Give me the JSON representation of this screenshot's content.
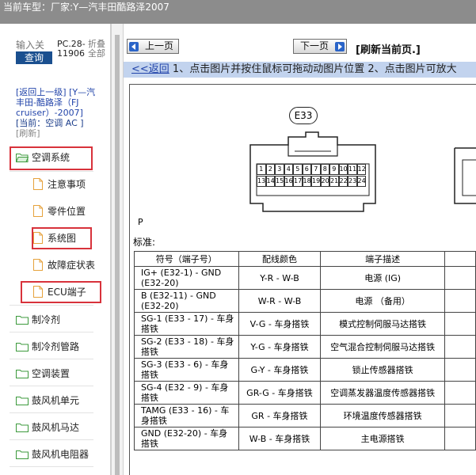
{
  "topbar": {
    "label": "当前车型：",
    "vehicle": "厂家:Y—汽丰田酷路泽2007"
  },
  "left": {
    "search_placeholder": "输入关",
    "search_button": "查询",
    "version_line1": "PC.28-",
    "version_line2": "11906",
    "fold_line1": "折叠",
    "fold_line2": "全部",
    "nav": {
      "back_parent": "[返回上一级]",
      "path": "[Y—汽丰田-酷路泽（FJ cruiser）-2007]",
      "current": "[当前：空调 AC ]",
      "refresh": "[刷新]"
    },
    "tree": [
      {
        "label": "空调系统",
        "type": "folder-open",
        "highlighted": true
      },
      {
        "label": "注意事项",
        "type": "doc",
        "highlighted": false
      },
      {
        "label": "零件位置",
        "type": "doc",
        "highlighted": false
      },
      {
        "label": "系统图",
        "type": "doc",
        "highlighted": true
      },
      {
        "label": "故障症状表",
        "type": "doc",
        "highlighted": false
      },
      {
        "label": "ECU端子",
        "type": "doc",
        "highlighted": true
      },
      {
        "label": "制冷剂",
        "type": "folder",
        "highlighted": false
      },
      {
        "label": "制冷剂管路",
        "type": "folder",
        "highlighted": false
      },
      {
        "label": "空调装置",
        "type": "folder",
        "highlighted": false
      },
      {
        "label": "鼓风机单元",
        "type": "folder",
        "highlighted": false
      },
      {
        "label": "鼓风机马达",
        "type": "folder",
        "highlighted": false
      },
      {
        "label": "鼓风机电阻器",
        "type": "folder",
        "highlighted": false
      }
    ]
  },
  "right": {
    "prev_button": "上一页",
    "next_button": "下一页",
    "refresh_page": "[刷新当前页.]",
    "hint_back": "<<返回",
    "hint_text": " 1、点击图片并按住鼠标可拖动动图片位置 2、点击图片可放大",
    "diagram": {
      "connector": "E33",
      "pins_row1": [
        "1",
        "2",
        "3",
        "4",
        "5",
        "6",
        "7",
        "8",
        "9",
        "10",
        "11",
        "12"
      ],
      "pins_row2": [
        "13",
        "14",
        "15",
        "16",
        "17",
        "18",
        "19",
        "20",
        "21",
        "22",
        "23",
        "24"
      ],
      "view_label": "P",
      "standard_label": "标准:",
      "table": {
        "headers": [
          "符号（端子号）",
          "配线颜色",
          "端子描述"
        ],
        "rows": [
          [
            "IG+ (E32-1) - GND (E32-20)",
            "Y-R - W-B",
            "电源 (IG)"
          ],
          [
            "B (E32-11) - GND (E32-20)",
            "W-R - W-B",
            "电源 （备用）"
          ],
          [
            "SG-1 (E33 - 17) - 车身搭铁",
            "V-G - 车身搭铁",
            "模式控制伺服马达搭铁"
          ],
          [
            "SG-2 (E33 - 18) - 车身搭铁",
            "Y-G - 车身搭铁",
            "空气混合控制伺服马达搭铁"
          ],
          [
            "SG-3 (E33 - 6) - 车身搭铁",
            "G-Y - 车身搭铁",
            "锁止传感器搭铁"
          ],
          [
            "SG-4 (E32 - 9) - 车身搭铁",
            "GR-G - 车身搭铁",
            "空调蒸发器温度传感器搭铁"
          ],
          [
            "TAMG (E33 - 16) - 车身搭铁",
            "GR - 车身搭铁",
            "环境温度传感器搭铁"
          ],
          [
            "GND (E32-20) - 车身搭铁",
            "W-B - 车身搭铁",
            "主电源搭铁"
          ]
        ]
      }
    }
  }
}
